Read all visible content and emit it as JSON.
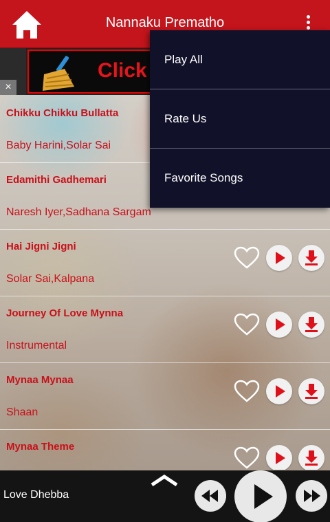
{
  "header": {
    "title": "Nannaku Prematho",
    "home_icon": "home-icon",
    "menu_icon": "more-vert-icon"
  },
  "ad": {
    "text": "Click t",
    "close_label": "×"
  },
  "songs": [
    {
      "title": "Chikku Chikku Bullatta",
      "artist": "Baby Harini,Solar Sai"
    },
    {
      "title": "Edamithi Gadhemari",
      "artist": "Naresh Iyer,Sadhana Sargam"
    },
    {
      "title": "Hai Jigni Jigni",
      "artist": "Solar Sai,Kalpana"
    },
    {
      "title": "Journey Of Love Mynna",
      "artist": "Instrumental"
    },
    {
      "title": "Mynaa Mynaa",
      "artist": "Shaan"
    },
    {
      "title": "Mynaa Theme",
      "artist": ""
    }
  ],
  "menu": {
    "items": [
      "Play All",
      "Rate Us",
      "Favorite Songs"
    ]
  },
  "player": {
    "now_playing": "Love Dhebba"
  },
  "colors": {
    "brand_red": "#c4141c",
    "text_red": "#c8101a",
    "menu_bg": "#11112a",
    "player_bg": "#141414"
  }
}
